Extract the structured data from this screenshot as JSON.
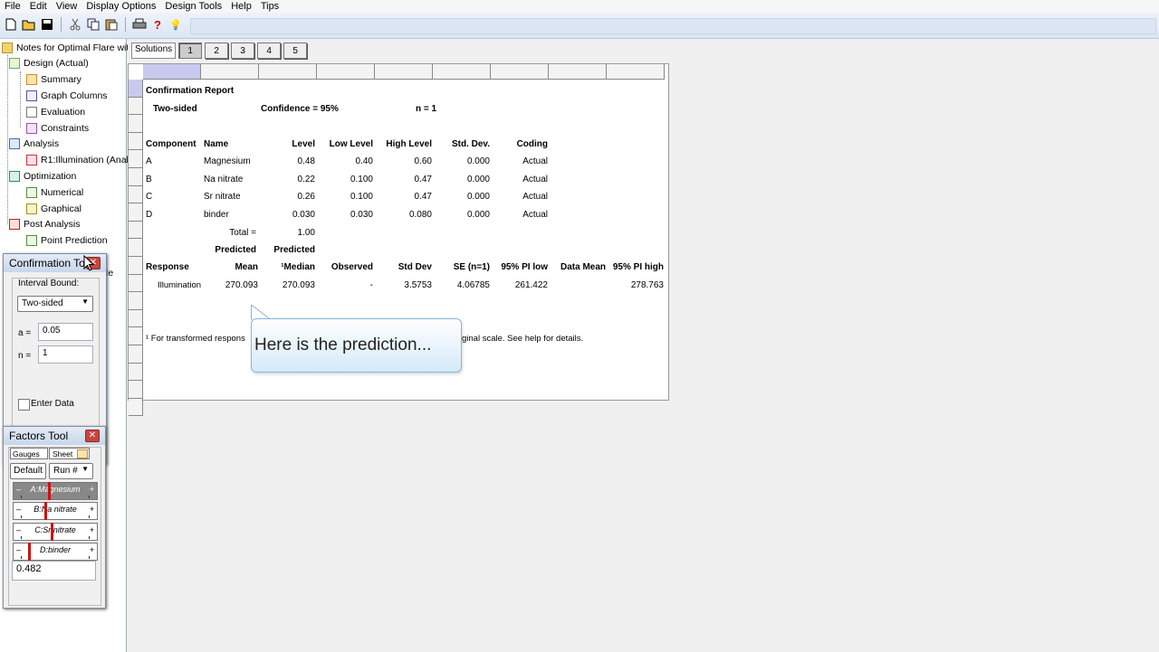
{
  "menu": [
    "File",
    "Edit",
    "View",
    "Display Options",
    "Design Tools",
    "Help",
    "Tips"
  ],
  "toolbar": {
    "icons": [
      "new-icon",
      "open-icon",
      "save-icon",
      "cut-icon",
      "copy-icon",
      "paste-icon",
      "print-icon",
      "help-icon",
      "tip-icon"
    ],
    "help_glyph": "?",
    "tip_glyph": "💡"
  },
  "tree": {
    "root": "Notes for Optimal Flare wit",
    "items": [
      {
        "label": "Design (Actual)"
      },
      {
        "label": "Summary"
      },
      {
        "label": "Graph Columns"
      },
      {
        "label": "Evaluation"
      },
      {
        "label": "Constraints"
      },
      {
        "label": "Analysis"
      },
      {
        "label": "R1:Illumination (Anal"
      },
      {
        "label": "Optimization"
      },
      {
        "label": "Numerical"
      },
      {
        "label": "Graphical"
      },
      {
        "label": "Post Analysis"
      },
      {
        "label": "Point Prediction"
      }
    ],
    "hidden_tail": "le"
  },
  "solutions": {
    "label": "Solutions",
    "buttons": [
      "1",
      "2",
      "3",
      "4",
      "5"
    ],
    "active": "1"
  },
  "report": {
    "title": "Confirmation Report",
    "sided": "Two-sided",
    "confidence": "Confidence = 95%",
    "n": "n =  1",
    "comp_headers": [
      "Component",
      "Name",
      "Level",
      "Low Level",
      "High Level",
      "Std. Dev.",
      "Coding"
    ],
    "components": [
      [
        "A",
        "Magnesium",
        "0.48",
        "0.40",
        "0.60",
        "0.000",
        "Actual"
      ],
      [
        "B",
        "Na nitrate",
        "0.22",
        "0.100",
        "0.47",
        "0.000",
        "Actual"
      ],
      [
        "C",
        "Sr nitrate",
        "0.26",
        "0.100",
        "0.47",
        "0.000",
        "Actual"
      ],
      [
        "D",
        "binder",
        "0.030",
        "0.030",
        "0.080",
        "0.000",
        "Actual"
      ]
    ],
    "total_label": "Total =",
    "total_value": "1.00",
    "pred_h1": "Predicted",
    "pred_h2": "Predicted",
    "resp_headers": [
      "Response",
      "Mean",
      "¹Median",
      "Observed",
      "Std Dev",
      "SE (n=1)",
      "95% PI low",
      "Data Mean",
      "95% PI high"
    ],
    "response_row": [
      "Illumination",
      "270.093",
      "270.093",
      "-",
      "3.5753",
      "4.06785",
      "261.422",
      "",
      "278.763"
    ],
    "footnote_left": "¹ For transformed respons",
    "footnote_right": "ginal scale. See help for details."
  },
  "callout": {
    "text": "Here is the prediction..."
  },
  "confirmation_tool": {
    "title": "Confirmation Too",
    "close": "✕",
    "interval_label": "Interval Bound:",
    "interval_value": "Two-sided",
    "alpha_label": "a =",
    "alpha_value": "0.05",
    "n_label": "n =",
    "n_value": "1",
    "enter_data_label": "Enter Data"
  },
  "factors_tool": {
    "title": "Factors Tool",
    "close": "✕",
    "tab_gauges": "Gauges",
    "tab_sheet": "Sheet",
    "default_label": "Default",
    "run_label": "Run #",
    "gauges": [
      {
        "name": "A:Magnesium",
        "level": 0.4,
        "highlight": true
      },
      {
        "name": "B:Na nitrate",
        "level": 0.34,
        "highlight": false
      },
      {
        "name": "C:Sr nitrate",
        "level": 0.43,
        "highlight": false
      },
      {
        "name": "D:binder",
        "level": 0.1,
        "highlight": false
      }
    ],
    "value": "0.482",
    "minus": "–",
    "plus": "+"
  },
  "colors": {
    "selection": "#c9c9ef",
    "close_red": "#c7463e",
    "gauge_marker": "#d01010",
    "callout_border": "#86b5dc"
  }
}
